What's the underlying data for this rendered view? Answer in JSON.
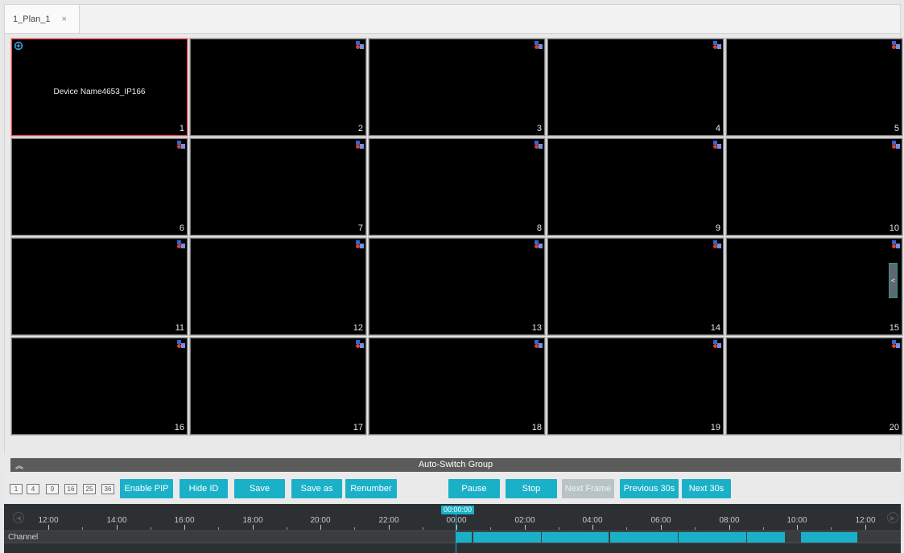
{
  "tabs": [
    {
      "label": "1_Plan_1",
      "close": "×"
    }
  ],
  "cells": [
    {
      "num": "1",
      "title": "Device Name4653_IP166",
      "selected": true,
      "icon": "fisheye-icon"
    },
    {
      "num": "2"
    },
    {
      "num": "3"
    },
    {
      "num": "4"
    },
    {
      "num": "5"
    },
    {
      "num": "6"
    },
    {
      "num": "7"
    },
    {
      "num": "8"
    },
    {
      "num": "9"
    },
    {
      "num": "10"
    },
    {
      "num": "11"
    },
    {
      "num": "12"
    },
    {
      "num": "13"
    },
    {
      "num": "14"
    },
    {
      "num": "15"
    },
    {
      "num": "16"
    },
    {
      "num": "17"
    },
    {
      "num": "18"
    },
    {
      "num": "19"
    },
    {
      "num": "20"
    }
  ],
  "side_toggle": "<",
  "group_bar": {
    "collapse_icon": "︽",
    "title": "Auto-Switch Group"
  },
  "layout_buttons": [
    "1",
    "4",
    "9",
    "16",
    "25",
    "36"
  ],
  "buttons": {
    "enable_pip": "Enable PIP",
    "hide_id": "Hide ID",
    "save": "Save",
    "save_as": "Save as",
    "renumber": "Renumber",
    "pause": "Pause",
    "stop": "Stop",
    "next_frame": "Next Frame",
    "previous_30s": "Previous 30s",
    "next_30s": "Next 30s"
  },
  "timeline": {
    "cursor_time": "00:00:00",
    "channel_label": "Channel",
    "ticks": [
      "12:00",
      "14:00",
      "16:00",
      "18:00",
      "20:00",
      "22:00",
      "00:00",
      "02:00",
      "04:00",
      "06:00",
      "08:00",
      "10:00",
      "12:00"
    ]
  },
  "colors": {
    "accent": "#1ab1c8",
    "selected_border": "#e0484f",
    "timeline_bg": "#2d3033"
  }
}
